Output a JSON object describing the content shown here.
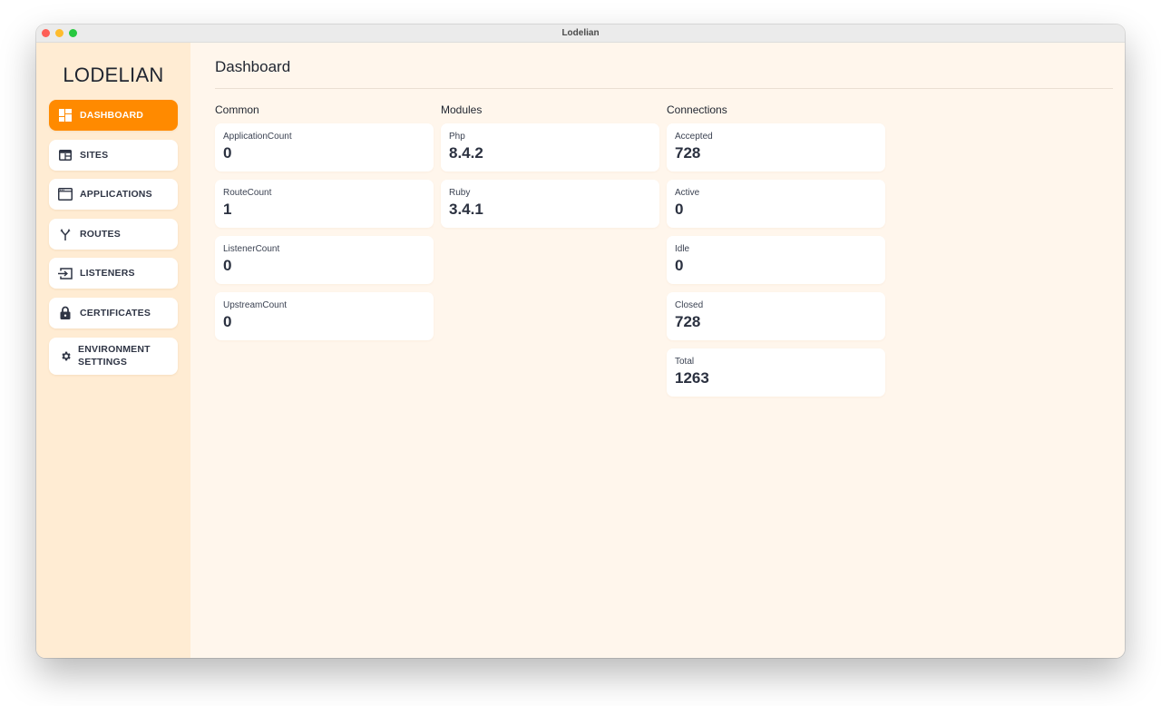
{
  "window": {
    "title": "Lodelian"
  },
  "sidebar": {
    "brand": "LODELIAN",
    "items": [
      {
        "label": "DASHBOARD",
        "icon": "dashboard-icon",
        "active": true
      },
      {
        "label": "SITES",
        "icon": "sites-icon",
        "active": false
      },
      {
        "label": "APPLICATIONS",
        "icon": "applications-icon",
        "active": false
      },
      {
        "label": "ROUTES",
        "icon": "routes-icon",
        "active": false
      },
      {
        "label": "LISTENERS",
        "icon": "listeners-icon",
        "active": false
      },
      {
        "label": "CERTIFICATES",
        "icon": "lock-icon",
        "active": false
      },
      {
        "label": "ENVIRONMENT SETTINGS",
        "label_line1": "ENVIRONMENT",
        "label_line2": "SETTINGS",
        "icon": "gear-icon",
        "active": false
      }
    ]
  },
  "main": {
    "title": "Dashboard",
    "sections": [
      {
        "title": "Common",
        "cards": [
          {
            "label": "ApplicationCount",
            "value": "0"
          },
          {
            "label": "RouteCount",
            "value": "1"
          },
          {
            "label": "ListenerCount",
            "value": "0"
          },
          {
            "label": "UpstreamCount",
            "value": "0"
          }
        ]
      },
      {
        "title": "Modules",
        "cards": [
          {
            "label": "Php",
            "value": "8.4.2"
          },
          {
            "label": "Ruby",
            "value": "3.4.1"
          }
        ]
      },
      {
        "title": "Connections",
        "cards": [
          {
            "label": "Accepted",
            "value": "728"
          },
          {
            "label": "Active",
            "value": "0"
          },
          {
            "label": "Idle",
            "value": "0"
          },
          {
            "label": "Closed",
            "value": "728"
          },
          {
            "label": "Total",
            "value": "1263"
          }
        ]
      }
    ]
  },
  "colors": {
    "accent": "#ff8a00",
    "sidebar_bg": "#ffecd3",
    "main_bg": "#fff6ec",
    "text": "#2b3140"
  }
}
